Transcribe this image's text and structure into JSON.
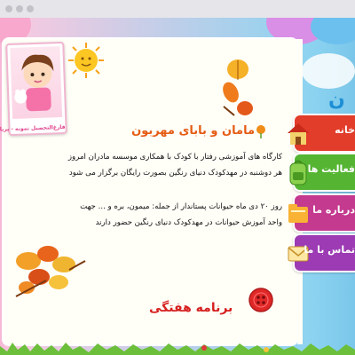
{
  "site": {
    "logo_fragment": "ن"
  },
  "card": {
    "caption": "فارغ‌التحصیل نمونه - پریا کنس"
  },
  "article": {
    "title": "مامان و بابای مهربون",
    "paragraph_1_line_1": "کارگاه های آموزشی رفتار با کودک با همکاری موسسه مادران امروز",
    "paragraph_1_line_2": "هر دوشنبه در مهدکودک دنیای رنگین بصورت رایگان برگزار می شود",
    "paragraph_2_line_1": "روز ۲۰ دی ماه حیوانات پستاندار از جمله: میمون، بره و ... جهت",
    "paragraph_2_line_2": "واحد آموزش حیوانات در مهدکودک دنیای رنگین حضور دارند",
    "program_heading": "برنامه هفتگی"
  },
  "nav": {
    "items": [
      {
        "label": "خانه",
        "icon": "house-icon",
        "color": "#e23c2a"
      },
      {
        "label": "فعالیت ها",
        "icon": "backpack-icon",
        "color": "#55b533"
      },
      {
        "label": "درباره ما",
        "icon": "folder-icon",
        "color": "#c43a8f"
      },
      {
        "label": "تماس با ما",
        "icon": "envelope-icon",
        "color": "#9c3bb3"
      }
    ]
  },
  "colors": {
    "title": "#e55b13",
    "program": "#d62020",
    "paper": "#fffef7",
    "logo": "#1e8fd6"
  }
}
